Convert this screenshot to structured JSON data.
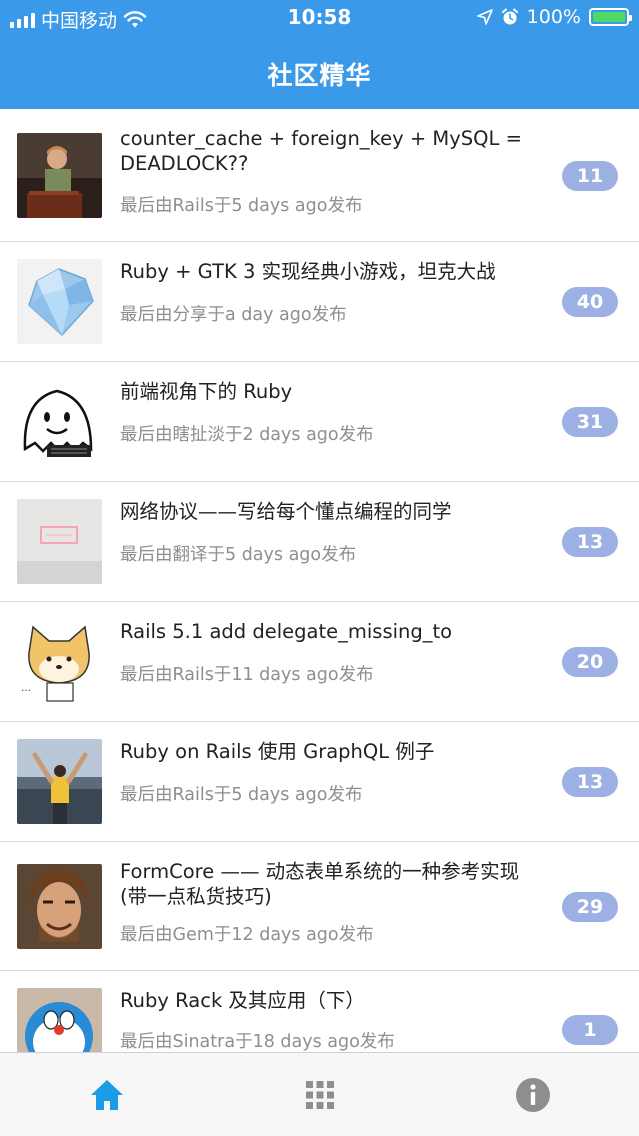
{
  "status_bar": {
    "carrier": "中国移动",
    "time": "10:58",
    "battery": "100%"
  },
  "nav": {
    "title": "社区精华"
  },
  "topics": [
    {
      "title": "counter_cache + foreign_key + MySQL = DEADLOCK??",
      "meta": "最后由Rails于5 days ago发布",
      "count": "11",
      "avatar": "speaker-photo"
    },
    {
      "title": "Ruby + GTK 3 实现经典小游戏，坦克大战",
      "meta": "最后由分享于a day ago发布",
      "count": "40",
      "avatar": "ruby-gem"
    },
    {
      "title": "前端视角下的 Ruby",
      "meta": "最后由瞎扯淡于2 days ago发布",
      "count": "31",
      "avatar": "ghost-drawing"
    },
    {
      "title": "网络协议——写给每个懂点编程的同学",
      "meta": "最后由翻译于5 days ago发布",
      "count": "13",
      "avatar": "neon-sign"
    },
    {
      "title": "Rails 5.1 add delegate_missing_to",
      "meta": "最后由Rails于11 days ago发布",
      "count": "20",
      "avatar": "shiba-doge"
    },
    {
      "title": "Ruby on Rails 使用 GraphQL 例子",
      "meta": "最后由Rails于5 days ago发布",
      "count": "13",
      "avatar": "person-lake"
    },
    {
      "title": "FormCore —— 动态表单系统的一种参考实现 (带一点私货技巧)",
      "meta": "最后由Gem于12 days ago发布",
      "count": "29",
      "avatar": "painted-portrait"
    },
    {
      "title": "Ruby Rack 及其应用（下）",
      "meta": "最后由Sinatra于18 days ago发布",
      "count": "1",
      "avatar": "doraemon"
    }
  ],
  "tabbar": {
    "tabs": [
      {
        "icon": "home-icon",
        "active": true
      },
      {
        "icon": "grid-icon",
        "active": false
      },
      {
        "icon": "info-icon",
        "active": false
      }
    ],
    "active_color": "#1a9de6",
    "inactive_color": "#8e8e8e"
  },
  "colors": {
    "header": "#3a99e8",
    "badge": "#9db0e3"
  }
}
